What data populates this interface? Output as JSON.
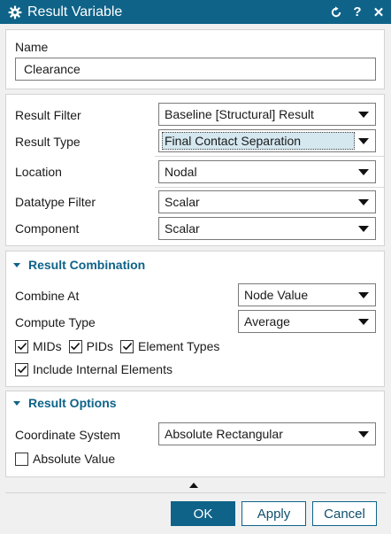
{
  "window": {
    "title": "Result Variable",
    "icons": {
      "gear": "gear-icon",
      "reset": "reset-icon",
      "help": "help-icon",
      "close": "close-icon"
    },
    "help_label": "?",
    "close_label": "✕"
  },
  "name_section": {
    "label": "Name",
    "value": "Clearance"
  },
  "result_section": {
    "result_filter": {
      "label": "Result Filter",
      "value": "Baseline [Structural] Result"
    },
    "result_type": {
      "label": "Result Type",
      "value": "Final Contact Separation"
    },
    "location": {
      "label": "Location",
      "value": "Nodal"
    },
    "datatype_filter": {
      "label": "Datatype Filter",
      "value": "Scalar"
    },
    "component": {
      "label": "Component",
      "value": "Scalar"
    }
  },
  "result_combination": {
    "title": "Result Combination",
    "combine_at": {
      "label": "Combine At",
      "value": "Node Value"
    },
    "compute_type": {
      "label": "Compute Type",
      "value": "Average"
    },
    "checkboxes": [
      {
        "label": "MIDs",
        "checked": true
      },
      {
        "label": "PIDs",
        "checked": true
      },
      {
        "label": "Element Types",
        "checked": true
      }
    ],
    "include_internal": {
      "label": "Include Internal Elements",
      "checked": true
    }
  },
  "result_options": {
    "title": "Result Options",
    "coordinate_system": {
      "label": "Coordinate System",
      "value": "Absolute Rectangular"
    },
    "absolute_value": {
      "label": "Absolute Value",
      "checked": false
    }
  },
  "buttons": {
    "ok": "OK",
    "apply": "Apply",
    "cancel": "Cancel"
  },
  "colors": {
    "accent": "#0f6389",
    "highlight": "#d5e8f0"
  }
}
